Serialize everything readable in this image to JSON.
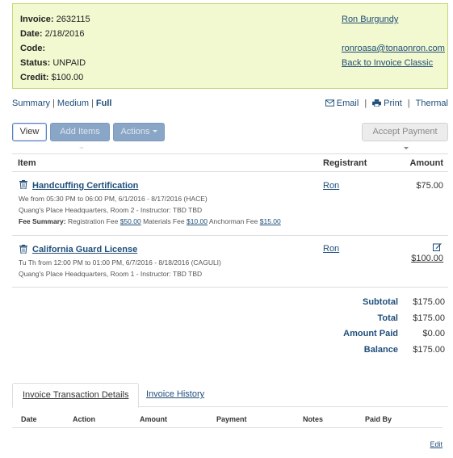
{
  "invoice": {
    "invoice_label": "Invoice:",
    "invoice_no": "2632115",
    "date_label": "Date:",
    "date": "2/18/2016",
    "code_label": "Code:",
    "code": "",
    "status_label": "Status:",
    "status": "UNPAID",
    "credit_label": "Credit:",
    "credit": "$100.00",
    "customer_name": "Ron Burgundy",
    "email": "ronroasa@tonaonron.com",
    "back_link": "Back to Invoice Classic"
  },
  "view_modes": {
    "summary": "Summary",
    "medium": "Medium",
    "full": "Full",
    "sep": "|"
  },
  "output_actions": {
    "email": "Email",
    "print": "Print",
    "thermal": "Thermal",
    "sep": "|"
  },
  "toolbar": {
    "view": "View",
    "add_items": "Add Items",
    "actions": "Actions",
    "accept_payment": "Accept Payment"
  },
  "table": {
    "headers": {
      "item": "Item",
      "registrant": "Registrant",
      "amount": "Amount"
    },
    "items": [
      {
        "title": "Handcuffing Certification",
        "schedule": "We from 05:30 PM to 06:00 PM, 6/1/2016 - 8/17/2016 (HACE)",
        "location": "Quang's Place Headquarters, Room 2 - Instructor: TBD TBD",
        "fee_summary_label": "Fee Summary:",
        "fee_reg_label": "Registration Fee",
        "fee_reg": "$50.00",
        "fee_mat_label": "Materials Fee",
        "fee_mat": "$10.00",
        "fee_anch_label": "Anchorman Fee",
        "fee_anch": "$15.00",
        "registrant": "Ron",
        "amount": "$75.00"
      },
      {
        "title": "California Guard License",
        "schedule": "Tu Th from 12:00 PM to 01:00 PM, 6/7/2016 - 8/18/2016 (CAGULI)",
        "location": "Quang's Place Headquarters, Room 1 - Instructor: TBD TBD",
        "registrant": "Ron",
        "amount": "$100.00"
      }
    ]
  },
  "totals": {
    "subtotal_label": "Subtotal",
    "subtotal": "$175.00",
    "total_label": "Total",
    "total": "$175.00",
    "amount_paid_label": "Amount Paid",
    "amount_paid": "$0.00",
    "balance_label": "Balance",
    "balance": "$175.00"
  },
  "tabs": {
    "transaction_details": "Invoice Transaction Details",
    "history": "Invoice History"
  },
  "transactions": {
    "headers": {
      "date": "Date",
      "action": "Action",
      "amount": "Amount",
      "payment": "Payment",
      "notes": "Notes",
      "paid_by": "Paid By"
    },
    "edit": "Edit"
  },
  "colors": {
    "header_bg": "#f2f8cf",
    "link": "#1f4e79",
    "disabled_button": "#8aa6c7"
  }
}
